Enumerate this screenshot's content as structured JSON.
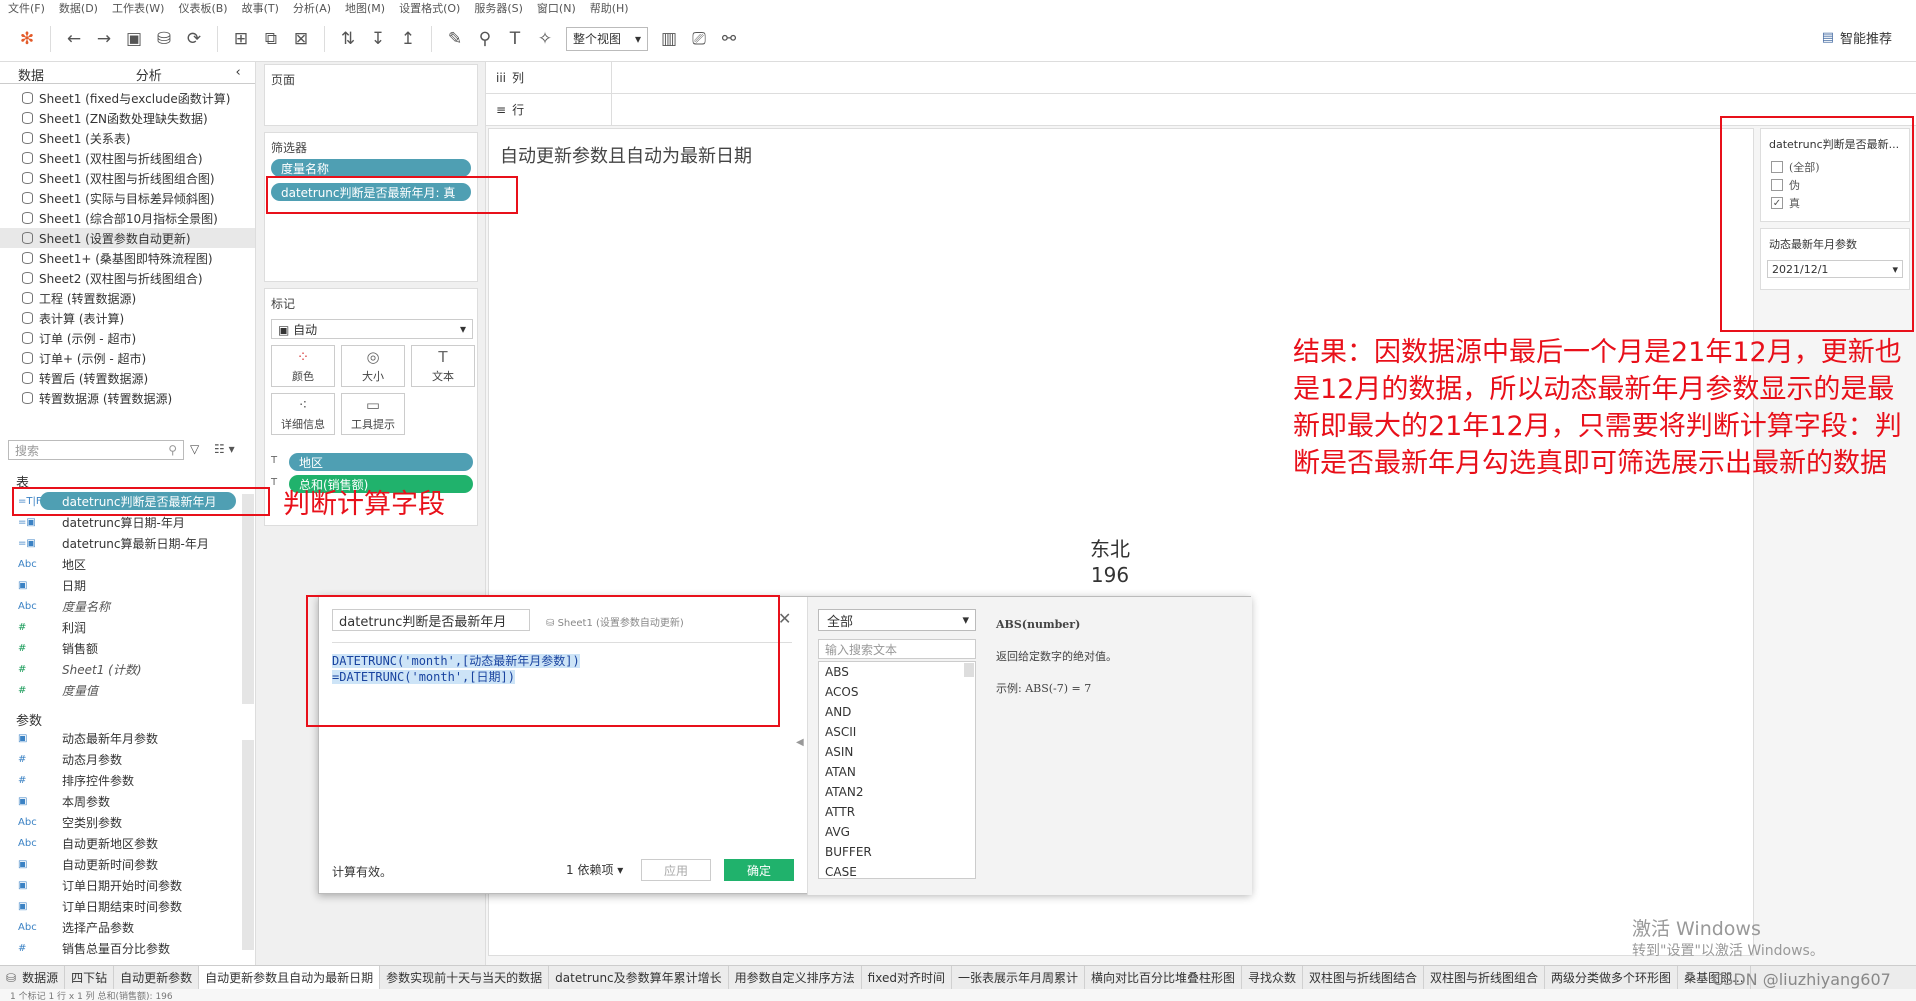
{
  "menu": [
    "文件(F)",
    "数据(D)",
    "工作表(W)",
    "仪表板(B)",
    "故事(T)",
    "分析(A)",
    "地图(M)",
    "设置格式(O)",
    "服务器(S)",
    "窗口(N)",
    "帮助(H)"
  ],
  "toolbar": {
    "view_mode": "整个视图",
    "smart_rec": "智能推荐"
  },
  "left_panel": {
    "tabs": [
      "数据",
      "分析"
    ],
    "datasources": [
      "Sheet1 (fixed与exclude函数计算)",
      "Sheet1 (ZN函数处理缺失数据)",
      "Sheet1 (关系表)",
      "Sheet1 (双柱图与折线图组合)",
      "Sheet1 (双柱图与折线图组合图)",
      "Sheet1 (实际与目标差异倾斜图)",
      "Sheet1 (综合部10月指标全景图)",
      "Sheet1 (设置参数自动更新)",
      "Sheet1+ (桑基图即特殊流程图)",
      "Sheet2 (双柱图与折线图组合)",
      "工程 (转置数据源)",
      "表计算 (表计算)",
      "订单 (示例 - 超市)",
      "订单+ (示例 - 超市)",
      "转置后 (转置数据源)",
      "转置数据源 (转置数据源)"
    ],
    "selected_index": 7,
    "search_placeholder": "搜索",
    "tables_title": "表",
    "fields": [
      {
        "icon": "=T|F",
        "label": "datetrunc判断是否最新年月",
        "pill": true
      },
      {
        "icon": "=▣",
        "label": "datetrunc算日期-年月"
      },
      {
        "icon": "=▣",
        "label": "datetrunc算最新日期-年月"
      },
      {
        "icon": "Abc",
        "label": "地区"
      },
      {
        "icon": "▣",
        "label": "日期"
      },
      {
        "icon": "Abc",
        "label": "度量名称",
        "italic": true
      },
      {
        "icon": "#",
        "label": "利润",
        "green": true
      },
      {
        "icon": "#",
        "label": "销售额",
        "green": true
      },
      {
        "icon": "#",
        "label": "Sheet1 (计数)",
        "italic": true,
        "green": true
      },
      {
        "icon": "#",
        "label": "度量值",
        "italic": true,
        "green": true
      }
    ],
    "params_title": "参数",
    "params": [
      {
        "icon": "▣",
        "label": "动态最新年月参数"
      },
      {
        "icon": "#",
        "label": "动态月参数"
      },
      {
        "icon": "#",
        "label": "排序控件参数"
      },
      {
        "icon": "▣",
        "label": "本周参数"
      },
      {
        "icon": "Abc",
        "label": "空类别参数"
      },
      {
        "icon": "Abc",
        "label": "自动更新地区参数"
      },
      {
        "icon": "▣",
        "label": "自动更新时间参数"
      },
      {
        "icon": "▣",
        "label": "订单日期开始时间参数"
      },
      {
        "icon": "▣",
        "label": "订单日期结束时间参数"
      },
      {
        "icon": "Abc",
        "label": "选择产品参数"
      },
      {
        "icon": "#",
        "label": "销售总量百分比参数"
      }
    ]
  },
  "cards": {
    "pages": "页面",
    "filters": "筛选器",
    "filter_pills": [
      "度量名称",
      "datetrunc判断是否最新年月: 真"
    ],
    "marks": "标记",
    "mark_type": "自动",
    "mark_buttons": [
      "颜色",
      "大小",
      "文本",
      "详细信息",
      "工具提示"
    ],
    "mark_pills": [
      "地区",
      "总和(销售额)"
    ]
  },
  "shelves": {
    "columns": "列",
    "rows": "行"
  },
  "viz": {
    "title": "自动更新参数且自动为最新日期",
    "region": "东北",
    "value": "196"
  },
  "right_panel": {
    "filter_title": "datetrunc判断是否最新...",
    "options": [
      {
        "label": "(全部)",
        "checked": false
      },
      {
        "label": "伪",
        "checked": false
      },
      {
        "label": "真",
        "checked": true
      }
    ],
    "param_title": "动态最新年月参数",
    "param_value": "2021/12/1"
  },
  "annotation": {
    "note": "结果：因数据源中最后一个月是21年12月，更新也是12月的数据，所以动态最新年月参数显示的是最新即最大的21年12月，只需要将判断计算字段：判断是否最新年月勾选真即可筛选展示出最新的数据",
    "calc_field_label": "判断计算字段"
  },
  "calc_dialog": {
    "name": "datetrunc判断是否最新年月",
    "sheet": "Sheet1 (设置参数自动更新)",
    "formula": [
      "DATETRUNC('month',[动态最新年月参数])",
      "=DATETRUNC('month',[日期])"
    ],
    "status": "计算有效。",
    "deps": "1 依赖项 ▾",
    "apply": "应用",
    "ok": "确定",
    "fn_category": "全部",
    "fn_search_placeholder": "输入搜索文本",
    "functions": [
      "ABS",
      "ACOS",
      "AND",
      "ASCII",
      "ASIN",
      "ATAN",
      "ATAN2",
      "ATTR",
      "AVG",
      "BUFFER",
      "CASE"
    ],
    "help_sig": "ABS(number)",
    "help_desc": "返回给定数字的绝对值。",
    "help_example": "示例: ABS(-7) = 7"
  },
  "bottom_tabs": [
    "数据源",
    "四下钻",
    "自动更新参数",
    "自动更新参数且自动为最新日期",
    "参数实现前十天与当天的数据",
    "datetrunc及参数算年累计增长",
    "用参数自定义排序方法",
    "fixed对齐时间",
    "一张表展示年月周累计",
    "横向对比百分比堆叠柱形图",
    "寻找众数",
    "双柱图与折线图结合",
    "双柱图与折线图组合",
    "两级分类做多个环形图",
    "桑基图即..."
  ],
  "active_tab_index": 3,
  "status_text": "1 个标记   1 行 x 1 列   总和(销售额): 196",
  "watermark": {
    "line1": "激活 Windows",
    "line2": "转到\"设置\"以激活 Windows。"
  },
  "csdn": "CSDN @liuzhiyang607"
}
